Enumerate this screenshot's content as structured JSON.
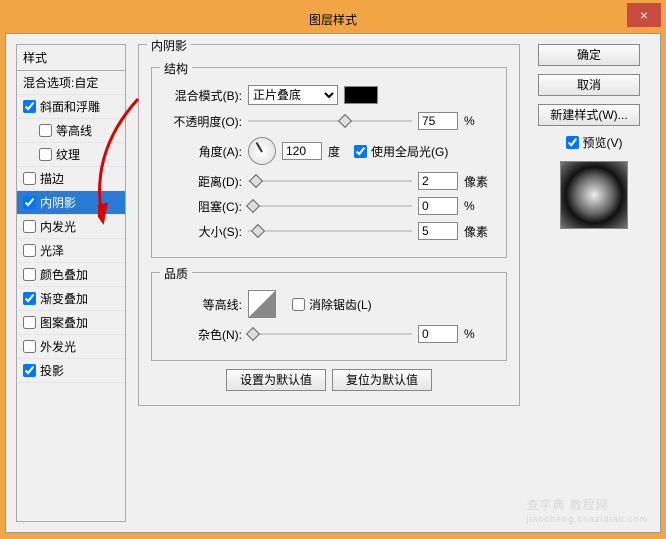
{
  "title": "图层样式",
  "close": "×",
  "sidebar": {
    "header": "样式",
    "blend": "混合选项:自定",
    "items": [
      {
        "label": "斜面和浮雕",
        "checked": true,
        "indent": false
      },
      {
        "label": "等高线",
        "checked": false,
        "indent": true
      },
      {
        "label": "纹理",
        "checked": false,
        "indent": true
      },
      {
        "label": "描边",
        "checked": false,
        "indent": false
      },
      {
        "label": "内阴影",
        "checked": true,
        "indent": false,
        "selected": true
      },
      {
        "label": "内发光",
        "checked": false,
        "indent": false
      },
      {
        "label": "光泽",
        "checked": false,
        "indent": false
      },
      {
        "label": "颜色叠加",
        "checked": false,
        "indent": false
      },
      {
        "label": "渐变叠加",
        "checked": true,
        "indent": false
      },
      {
        "label": "图案叠加",
        "checked": false,
        "indent": false
      },
      {
        "label": "外发光",
        "checked": false,
        "indent": false
      },
      {
        "label": "投影",
        "checked": true,
        "indent": false
      }
    ]
  },
  "panel": {
    "title": "内阴影",
    "struct": "结构",
    "blendmode_lbl": "混合模式(B):",
    "blendmode_val": "正片叠底",
    "opacity_lbl": "不透明度(O):",
    "opacity_val": "75",
    "opacity_pct": 59,
    "pct": "%",
    "angle_lbl": "角度(A):",
    "angle_val": "120",
    "degree": "度",
    "global": "使用全局光(G)",
    "distance_lbl": "距离(D):",
    "distance_val": "2",
    "px": "像素",
    "choke_lbl": "阻塞(C):",
    "choke_val": "0",
    "size_lbl": "大小(S):",
    "size_val": "5",
    "quality": "品质",
    "contour_lbl": "等高线:",
    "antialias": "消除锯齿(L)",
    "noise_lbl": "杂色(N):",
    "noise_val": "0",
    "set_default": "设置为默认值",
    "reset_default": "复位为默认值"
  },
  "right": {
    "ok": "确定",
    "cancel": "取消",
    "newstyle": "新建样式(W)...",
    "preview": "预览(V)"
  },
  "watermark": {
    "big": "查字典 教程网",
    "small": "jiaocheng.chazidian.com"
  }
}
